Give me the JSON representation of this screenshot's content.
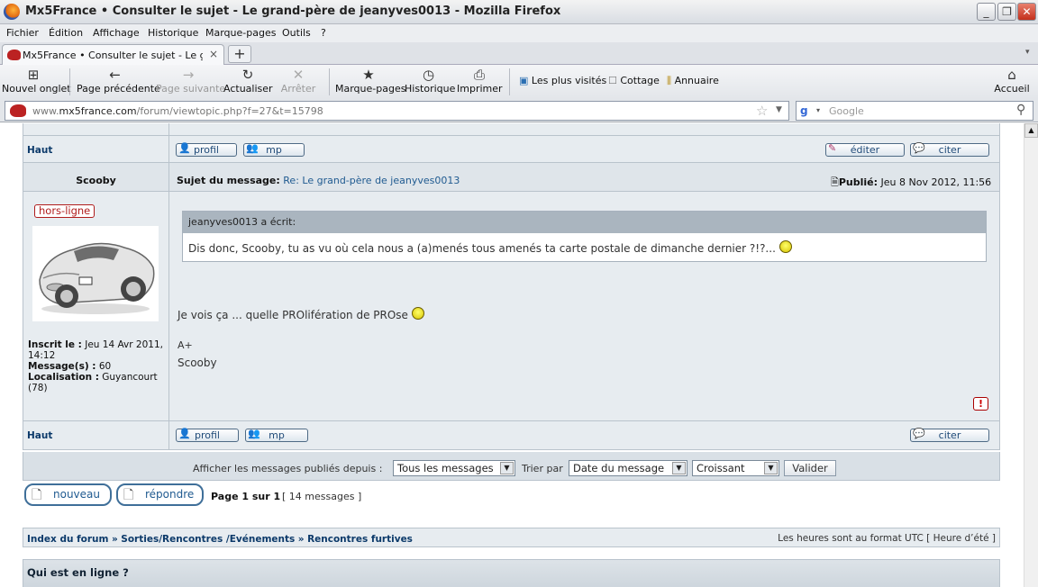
{
  "window": {
    "title": "Mx5France • Consulter le sujet - Le grand-père de jeanyves0013 - Mozilla Firefox",
    "minimize": "_",
    "maximize": "❐",
    "close": "✕"
  },
  "menu": [
    "Fichier",
    "Édition",
    "Affichage",
    "Historique",
    "Marque-pages",
    "Outils",
    "?"
  ],
  "tab": {
    "label": "Mx5France • Consulter le sujet - Le grand-p...",
    "close": "×",
    "newtab": "+"
  },
  "toolbar": {
    "new_tab": "Nouvel onglet",
    "back": "Page précédente",
    "forward": "Page suivante",
    "reload": "Actualiser",
    "stop": "Arrêter",
    "bookmarks": "Marque-pages",
    "history": "Historique",
    "print": "Imprimer",
    "most_visited": "Les plus visités",
    "cottage": "Cottage",
    "annuaire": "Annuaire",
    "home": "Accueil"
  },
  "address": {
    "prefix": "www.",
    "domain": "mx5france.com",
    "path": "/forum/viewtopic.php?f=27&t=15798"
  },
  "search": {
    "placeholder": "Google"
  },
  "post_prev": {
    "haut": "Haut",
    "profil": "profil",
    "mp": "mp",
    "editer": "éditer",
    "citer": "citer"
  },
  "post": {
    "author": "Scooby",
    "subject_label": "Sujet du message:",
    "subject": "Re: Le grand-père de jeanyves0013",
    "published_label": "Publié:",
    "published": "Jeu 8 Nov 2012, 11:56",
    "status": "hors-ligne",
    "inscrit_label": "Inscrit le :",
    "inscrit": "Jeu 14 Avr 2011, 14:12",
    "messages_label": "Message(s) :",
    "messages": "60",
    "localisation_label": "Localisation :",
    "localisation": "Guyancourt (78)",
    "quote_header": "jeanyves0013 a écrit:",
    "quote_body": "Dis donc, Scooby, tu as vu où cela nous a (a)menés tous amenés ta carte postale de dimanche dernier ?!?...",
    "body_line1": "Je vois ça ... quelle PROlifération de PROse",
    "body_line2": "A+",
    "body_line3": "Scooby",
    "report": "!",
    "haut": "Haut",
    "profil": "profil",
    "mp": "mp",
    "citer": "citer"
  },
  "filter": {
    "display_label": "Afficher les messages publiés depuis :",
    "display_value": "Tous les messages",
    "sort_label": "Trier par",
    "sort_value": "Date du message",
    "order_value": "Croissant",
    "submit": "Valider"
  },
  "actions": {
    "new": "nouveau",
    "reply": "répondre",
    "pages": "Page 1 sur 1",
    "count": "[ 14 messages ]"
  },
  "breadcrumb": {
    "index": "Index du forum",
    "sep": "»",
    "cat": "Sorties/Rencontres /Evénements",
    "forum": "Rencontres furtives",
    "tz": "Les heures sont au format UTC [ Heure d’été ]"
  },
  "online": {
    "title": "Qui est en ligne ?"
  }
}
